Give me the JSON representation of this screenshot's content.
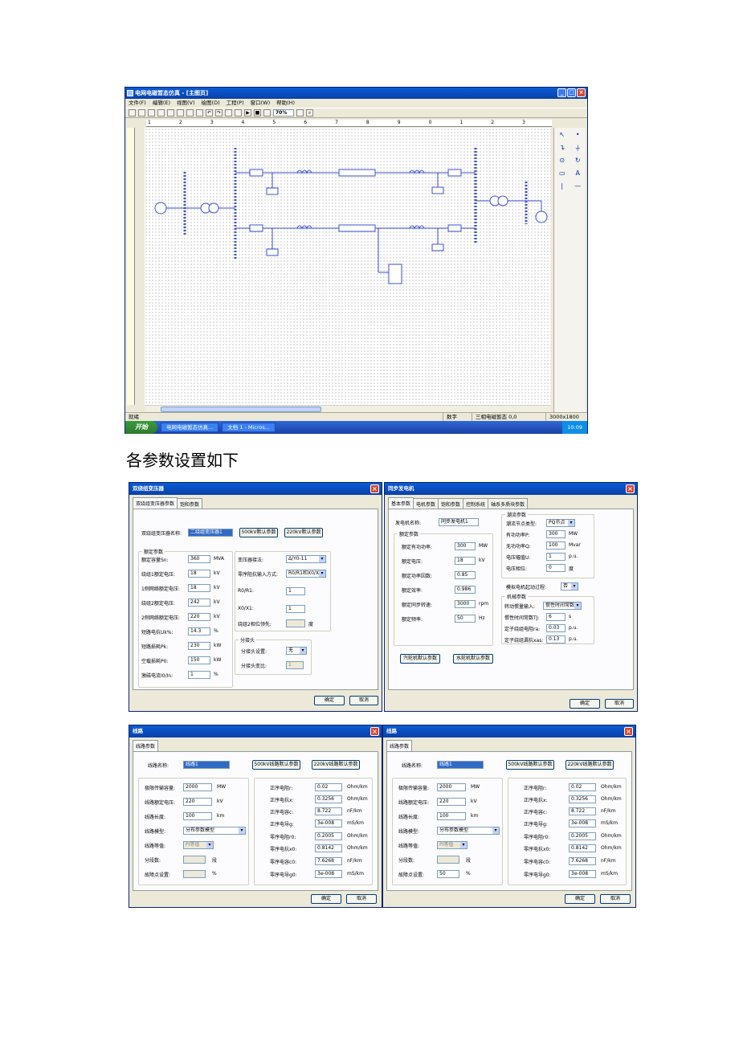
{
  "app": {
    "title": "电网电磁暂态仿真 - [主图页]",
    "menu": [
      "文件(F)",
      "编辑(E)",
      "视图(V)",
      "绘图(D)",
      "工程(P)",
      "窗口(W)",
      "帮助(H)"
    ],
    "zoom": "70%",
    "ruler_top": [
      "1",
      "2",
      "3",
      "4",
      "5",
      "6",
      "7",
      "8",
      "9",
      "0",
      "1",
      "2",
      "3"
    ],
    "status": {
      "left": "就绪",
      "mode": "数字",
      "sim": "三相电磁暂态 0,0",
      "size": "3000x1800"
    },
    "taskbar": {
      "start": "开始",
      "task1": "电网电磁暂态仿真...",
      "task2": "文档 1 - Micros...",
      "clock": "10:09"
    }
  },
  "caption": "各参数设置如下",
  "dlg_transformer": {
    "title": "双绕组变压器",
    "tabs": [
      "双绕组变压器参数",
      "饱和参数"
    ],
    "name_label": "双绕组变压器名称:",
    "name_value": "二绕组变压器1",
    "btn_500": "500kV默认参数",
    "btn_220": "220kV默认参数",
    "rated_group": "额定参数",
    "rows": [
      {
        "label": "额定容量Sn:",
        "value": "360",
        "unit": "MVA"
      },
      {
        "label": "绕组1额定电压:",
        "value": "18",
        "unit": "kV"
      },
      {
        "label": "1侧网络额定电压:",
        "value": "18",
        "unit": "kV"
      },
      {
        "label": "绕组2额定电压:",
        "value": "242",
        "unit": "kV"
      },
      {
        "label": "2侧网络额定电压:",
        "value": "220",
        "unit": "kV"
      },
      {
        "label": "短路电抗Uk%:",
        "value": "14.3",
        "unit": "%"
      },
      {
        "label": "短路损耗Pk:",
        "value": "230",
        "unit": "kW"
      },
      {
        "label": "空载损耗P0:",
        "value": "150",
        "unit": "kW"
      },
      {
        "label": "激磁电流I0/In:",
        "value": "1",
        "unit": "%"
      }
    ],
    "conn_label": "变压器接法:",
    "conn_value": "Δ/Y0-11",
    "zero_label": "零序阻抗输入方式:",
    "zero_value": "R0/R1和X0/X1",
    "r0r1_label": "R0/R1:",
    "r0r1_value": "1",
    "x0x1_label": "X0/X1:",
    "x0x1_value": "1",
    "phase_label": "绕组2相位领先:",
    "phase_unit": "度",
    "tap_group": "分接头",
    "tap_set_label": "分接头设置:",
    "tap_set_value": "无",
    "tap_ratio_label": "分接头变比:",
    "tap_ratio_value": "1",
    "ok": "确定",
    "cancel": "取消"
  },
  "dlg_generator": {
    "title": "同步发电机",
    "tabs": [
      "基本参数",
      "电机参数",
      "饱和参数",
      "控制系统",
      "轴系多质块参数"
    ],
    "name_label": "发电机名称:",
    "name_value": "同步发电机1",
    "rated_group": "额定参数",
    "rows": [
      {
        "label": "额定有功功率:",
        "value": "300",
        "unit": "MW"
      },
      {
        "label": "额定电压:",
        "value": "18",
        "unit": "kV"
      },
      {
        "label": "额定功率因数:",
        "value": "0.85",
        "unit": ""
      },
      {
        "label": "额定效率:",
        "value": "0.986",
        "unit": ""
      },
      {
        "label": "额定同步转速:",
        "value": "3000",
        "unit": "rpm"
      },
      {
        "label": "额定频率:",
        "value": "50",
        "unit": "Hz"
      }
    ],
    "flow_group": "潮流参数",
    "flow_rows": [
      {
        "label": "潮流节点类型:",
        "value": "PQ节点",
        "unit": ""
      },
      {
        "label": "有功功率P:",
        "value": "300",
        "unit": "MW"
      },
      {
        "label": "无功功率Q:",
        "value": "100",
        "unit": "Mvar"
      },
      {
        "label": "电压幅值U:",
        "value": "1",
        "unit": "p.u."
      },
      {
        "label": "电压相位:",
        "value": "0",
        "unit": "度"
      }
    ],
    "start_label": "模拟电机起动过程:",
    "start_value": "否",
    "mech_group": "机械参数",
    "mech_rows": [
      {
        "label": "转动惯量输入:",
        "value": "惯性时间常数",
        "unit": ""
      },
      {
        "label": "惯性时间常数TJ:",
        "value": "6",
        "unit": "s"
      },
      {
        "label": "定子绕组电阻ra:",
        "value": "0.03",
        "unit": "p.u."
      },
      {
        "label": "定子绕组漏抗xas:",
        "value": "0.13",
        "unit": "p.u."
      }
    ],
    "btn_steam": "汽轮机默认参数",
    "btn_hydro": "水轮机默认参数",
    "ok": "确定",
    "cancel": "取消"
  },
  "dlg_line": {
    "title": "线路",
    "tab": "线路参数",
    "name_label": "线路名称:",
    "name_value": "线路1",
    "btn_500": "500kV线路默认参数",
    "btn_220": "220kV线路默认参数",
    "left_rows": [
      {
        "label": "极限传输容量:",
        "value": "2000",
        "unit": "MW"
      },
      {
        "label": "线路额定电压:",
        "value": "220",
        "unit": "kV"
      },
      {
        "label": "线路长度:",
        "value": "100",
        "unit": "km"
      }
    ],
    "model_label": "线路模型:",
    "model_value": "分布参数模型",
    "equiv_label": "线路等值:",
    "equiv_value": "PI等值",
    "seg_label": "分段数:",
    "seg_unit": "段",
    "fault_label": "故障点设置:",
    "fault_unit": "%",
    "right_rows": [
      {
        "label": "正序电阻r:",
        "value": "0.02",
        "unit": "Ohm/km"
      },
      {
        "label": "正序电抗x:",
        "value": "0.3256",
        "unit": "Ohm/km"
      },
      {
        "label": "正序电容c:",
        "value": "8.722",
        "unit": "nF/km"
      },
      {
        "label": "正序电导g:",
        "value": "3e-008",
        "unit": "mS/km"
      },
      {
        "label": "零序电阻r0:",
        "value": "0.2005",
        "unit": "Ohm/km"
      },
      {
        "label": "零序电抗x0:",
        "value": "0.8142",
        "unit": "Ohm/km"
      },
      {
        "label": "零序电容c0:",
        "value": "7.6268",
        "unit": "nF/km"
      },
      {
        "label": "零序电导g0:",
        "value": "3e-008",
        "unit": "mS/km"
      }
    ],
    "fault_value_b": "50",
    "ok": "确定",
    "cancel": "取消"
  }
}
